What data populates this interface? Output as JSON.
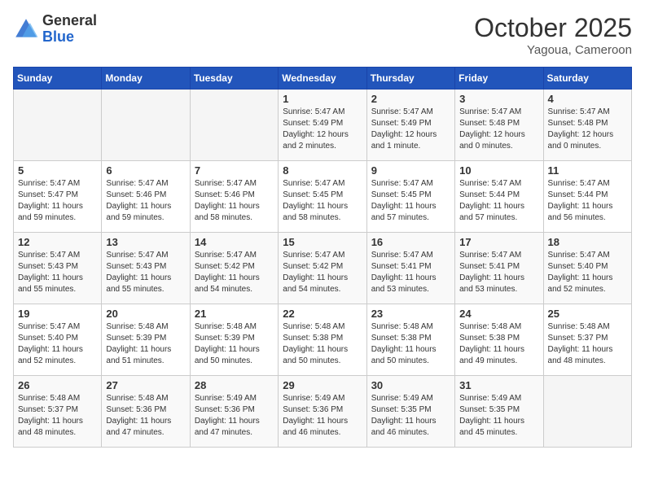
{
  "header": {
    "logo_general": "General",
    "logo_blue": "Blue",
    "month_title": "October 2025",
    "location": "Yagoua, Cameroon"
  },
  "days_of_week": [
    "Sunday",
    "Monday",
    "Tuesday",
    "Wednesday",
    "Thursday",
    "Friday",
    "Saturday"
  ],
  "weeks": [
    [
      {
        "day": "",
        "info": ""
      },
      {
        "day": "",
        "info": ""
      },
      {
        "day": "",
        "info": ""
      },
      {
        "day": "1",
        "info": "Sunrise: 5:47 AM\nSunset: 5:49 PM\nDaylight: 12 hours\nand 2 minutes."
      },
      {
        "day": "2",
        "info": "Sunrise: 5:47 AM\nSunset: 5:49 PM\nDaylight: 12 hours\nand 1 minute."
      },
      {
        "day": "3",
        "info": "Sunrise: 5:47 AM\nSunset: 5:48 PM\nDaylight: 12 hours\nand 0 minutes."
      },
      {
        "day": "4",
        "info": "Sunrise: 5:47 AM\nSunset: 5:48 PM\nDaylight: 12 hours\nand 0 minutes."
      }
    ],
    [
      {
        "day": "5",
        "info": "Sunrise: 5:47 AM\nSunset: 5:47 PM\nDaylight: 11 hours\nand 59 minutes."
      },
      {
        "day": "6",
        "info": "Sunrise: 5:47 AM\nSunset: 5:46 PM\nDaylight: 11 hours\nand 59 minutes."
      },
      {
        "day": "7",
        "info": "Sunrise: 5:47 AM\nSunset: 5:46 PM\nDaylight: 11 hours\nand 58 minutes."
      },
      {
        "day": "8",
        "info": "Sunrise: 5:47 AM\nSunset: 5:45 PM\nDaylight: 11 hours\nand 58 minutes."
      },
      {
        "day": "9",
        "info": "Sunrise: 5:47 AM\nSunset: 5:45 PM\nDaylight: 11 hours\nand 57 minutes."
      },
      {
        "day": "10",
        "info": "Sunrise: 5:47 AM\nSunset: 5:44 PM\nDaylight: 11 hours\nand 57 minutes."
      },
      {
        "day": "11",
        "info": "Sunrise: 5:47 AM\nSunset: 5:44 PM\nDaylight: 11 hours\nand 56 minutes."
      }
    ],
    [
      {
        "day": "12",
        "info": "Sunrise: 5:47 AM\nSunset: 5:43 PM\nDaylight: 11 hours\nand 55 minutes."
      },
      {
        "day": "13",
        "info": "Sunrise: 5:47 AM\nSunset: 5:43 PM\nDaylight: 11 hours\nand 55 minutes."
      },
      {
        "day": "14",
        "info": "Sunrise: 5:47 AM\nSunset: 5:42 PM\nDaylight: 11 hours\nand 54 minutes."
      },
      {
        "day": "15",
        "info": "Sunrise: 5:47 AM\nSunset: 5:42 PM\nDaylight: 11 hours\nand 54 minutes."
      },
      {
        "day": "16",
        "info": "Sunrise: 5:47 AM\nSunset: 5:41 PM\nDaylight: 11 hours\nand 53 minutes."
      },
      {
        "day": "17",
        "info": "Sunrise: 5:47 AM\nSunset: 5:41 PM\nDaylight: 11 hours\nand 53 minutes."
      },
      {
        "day": "18",
        "info": "Sunrise: 5:47 AM\nSunset: 5:40 PM\nDaylight: 11 hours\nand 52 minutes."
      }
    ],
    [
      {
        "day": "19",
        "info": "Sunrise: 5:47 AM\nSunset: 5:40 PM\nDaylight: 11 hours\nand 52 minutes."
      },
      {
        "day": "20",
        "info": "Sunrise: 5:48 AM\nSunset: 5:39 PM\nDaylight: 11 hours\nand 51 minutes."
      },
      {
        "day": "21",
        "info": "Sunrise: 5:48 AM\nSunset: 5:39 PM\nDaylight: 11 hours\nand 50 minutes."
      },
      {
        "day": "22",
        "info": "Sunrise: 5:48 AM\nSunset: 5:38 PM\nDaylight: 11 hours\nand 50 minutes."
      },
      {
        "day": "23",
        "info": "Sunrise: 5:48 AM\nSunset: 5:38 PM\nDaylight: 11 hours\nand 50 minutes."
      },
      {
        "day": "24",
        "info": "Sunrise: 5:48 AM\nSunset: 5:38 PM\nDaylight: 11 hours\nand 49 minutes."
      },
      {
        "day": "25",
        "info": "Sunrise: 5:48 AM\nSunset: 5:37 PM\nDaylight: 11 hours\nand 48 minutes."
      }
    ],
    [
      {
        "day": "26",
        "info": "Sunrise: 5:48 AM\nSunset: 5:37 PM\nDaylight: 11 hours\nand 48 minutes."
      },
      {
        "day": "27",
        "info": "Sunrise: 5:48 AM\nSunset: 5:36 PM\nDaylight: 11 hours\nand 47 minutes."
      },
      {
        "day": "28",
        "info": "Sunrise: 5:49 AM\nSunset: 5:36 PM\nDaylight: 11 hours\nand 47 minutes."
      },
      {
        "day": "29",
        "info": "Sunrise: 5:49 AM\nSunset: 5:36 PM\nDaylight: 11 hours\nand 46 minutes."
      },
      {
        "day": "30",
        "info": "Sunrise: 5:49 AM\nSunset: 5:35 PM\nDaylight: 11 hours\nand 46 minutes."
      },
      {
        "day": "31",
        "info": "Sunrise: 5:49 AM\nSunset: 5:35 PM\nDaylight: 11 hours\nand 45 minutes."
      },
      {
        "day": "",
        "info": ""
      }
    ]
  ]
}
